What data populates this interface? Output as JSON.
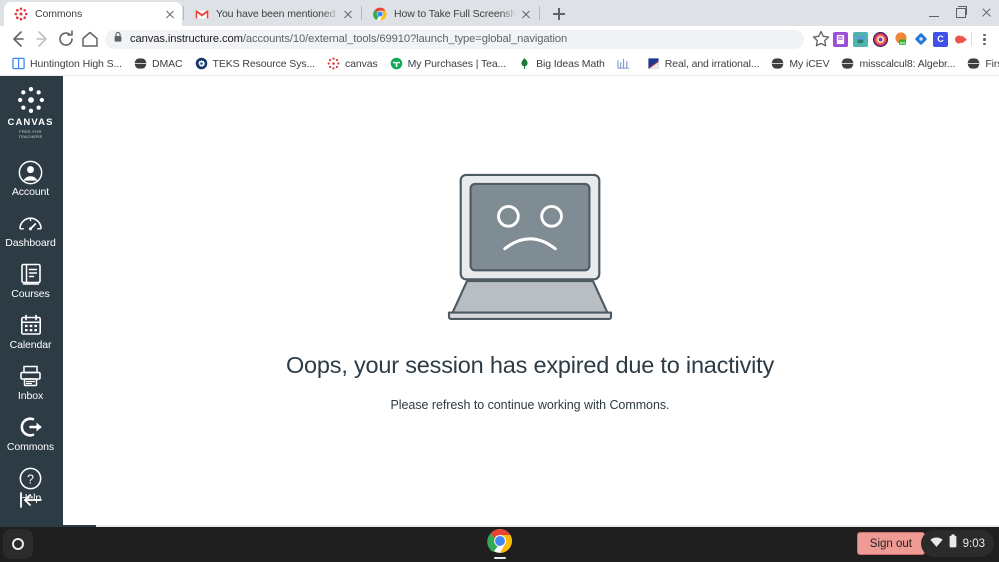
{
  "browser": {
    "tabs": [
      {
        "title": "Commons",
        "favicon": "canvas-dotted-circle-icon",
        "active": true
      },
      {
        "title": "You have been mentioned by Ste",
        "favicon": "gmail-icon",
        "active": false
      },
      {
        "title": "How to Take Full Screenshots - G",
        "favicon": "chrome-icon",
        "active": false
      }
    ],
    "new_tab_label": "+",
    "window_controls": {
      "minimize": "minimize-button",
      "maximize": "maximize-button",
      "close": "close-button"
    },
    "omnibox": {
      "url_domain": "canvas.instructure.com",
      "url_path": "/accounts/10/external_tools/69910?launch_type=global_navigation",
      "lock_icon": "lock-icon",
      "star_icon": "bookmark-star-icon"
    },
    "nav": {
      "back": "back-arrow-icon",
      "forward": "forward-arrow-icon",
      "reload": "reload-icon",
      "home": "home-icon"
    },
    "extensions": [
      {
        "name": "extension-purple",
        "color": "#9c4dd8",
        "glyph": "⚑"
      },
      {
        "name": "extension-screencast",
        "color": "#3aa0a0",
        "glyph": "▣"
      },
      {
        "name": "extension-instagram",
        "color": "#262626",
        "glyph": "◎"
      },
      {
        "name": "extension-orange",
        "color": "#f4883a",
        "glyph": "●"
      },
      {
        "name": "extension-blue-diamond",
        "color": "#2979d8",
        "glyph": "◆"
      },
      {
        "name": "extension-c-badge",
        "color": "#4040e0",
        "glyph": "C"
      },
      {
        "name": "extension-red-play",
        "color": "#ef5350",
        "glyph": "▶"
      }
    ],
    "menu_icon": "kebab-menu-icon",
    "bookmarks": [
      {
        "label": "Huntington High S...",
        "icon": "window-icon",
        "color": "#4285f4"
      },
      {
        "label": "DMAC",
        "icon": "globe-icon",
        "color": "#3c4043"
      },
      {
        "label": "TEKS Resource Sys...",
        "icon": "gear-badge-icon",
        "color": "#15386b"
      },
      {
        "label": "canvas",
        "icon": "canvas-dotted-circle-icon",
        "color": "#e4353a"
      },
      {
        "label": "My Purchases | Tea...",
        "icon": "teacherspayteachers-icon",
        "color": "#0fa958"
      },
      {
        "label": "Big Ideas Math",
        "icon": "leaf-icon",
        "color": "#1a7a3a"
      },
      {
        "label": "",
        "icon": "graph-icon",
        "color": "#7a9cc4"
      },
      {
        "label": "Real, and irrational...",
        "icon": "flag-icon",
        "color": "#1b3a8f"
      },
      {
        "label": "My iCEV",
        "icon": "globe-icon",
        "color": "#3c4043"
      },
      {
        "label": "misscalcul8: Algebr...",
        "icon": "globe-icon",
        "color": "#3c4043"
      },
      {
        "label": "First Day / Mrs. C b...",
        "icon": "globe-icon",
        "color": "#3c4043"
      }
    ],
    "bookmarks_overflow": "»"
  },
  "canvas": {
    "logo": {
      "title": "CANVAS",
      "subtitle": "FREE FOR TEACHERS",
      "icon": "canvas-dotted-circle-icon"
    },
    "nav_items": [
      {
        "label": "Account",
        "icon": "user-avatar-icon"
      },
      {
        "label": "Dashboard",
        "icon": "dashboard-gauge-icon"
      },
      {
        "label": "Courses",
        "icon": "book-icon"
      },
      {
        "label": "Calendar",
        "icon": "calendar-icon"
      },
      {
        "label": "Inbox",
        "icon": "inbox-tray-icon"
      },
      {
        "label": "Commons",
        "icon": "arrow-out-circle-icon"
      },
      {
        "label": "Help",
        "icon": "question-circle-icon"
      }
    ],
    "collapse": {
      "icon": "collapse-left-arrow-icon"
    },
    "nav_bg": "#2d3b45"
  },
  "main": {
    "illustration": "sad-laptop-icon",
    "title": "Oops, your session has expired due to inactivity",
    "subtitle": "Please refresh to continue working with Commons.",
    "text_color": "#2d3b45"
  },
  "shelf": {
    "launcher": "launcher-circle-icon",
    "apps": [
      {
        "name": "chrome-icon"
      }
    ],
    "sign_out_label": "Sign out",
    "sign_out_color": "#ef9a95",
    "status": {
      "wifi": "wifi-icon",
      "battery": "battery-icon",
      "time": "9:03"
    }
  }
}
